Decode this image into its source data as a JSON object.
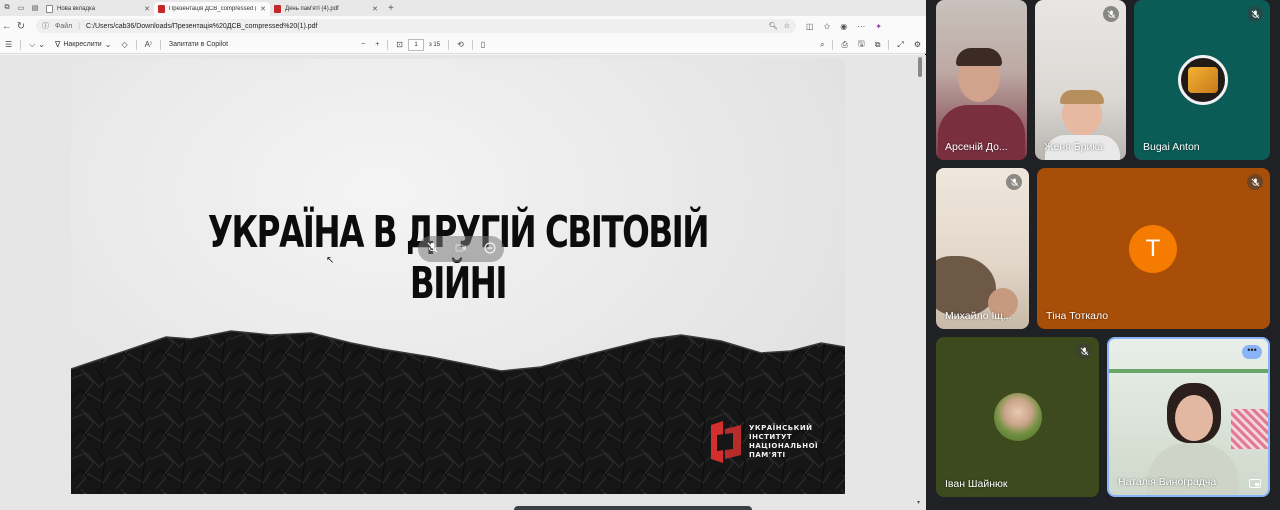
{
  "browser": {
    "tabs": [
      {
        "label": "Нова вкладка",
        "icon": "blank-page-icon",
        "active": false
      },
      {
        "label": "Презентація ДСВ_compressed (1)",
        "icon": "pdf-icon",
        "active": true
      },
      {
        "label": "День пам'яті (4).pdf",
        "icon": "pdf-icon",
        "active": false
      }
    ],
    "new_tab": "+",
    "address": {
      "protocol_label": "Файл",
      "url": "C:/Users/cab36/Downloads/Презентація%20ДСВ_compressed%20(1).pdf"
    },
    "pdf_toolbar": {
      "draw_label": "Накреслити",
      "copilot_label": "Запитати в Copilot",
      "zoom_out": "−",
      "zoom_in": "+",
      "page_current": "1",
      "page_total": "з 15"
    }
  },
  "slide": {
    "title": "УКРАЇНА В ДРУГІЙ СВІТОВІЙ ВІЙНІ",
    "logo_lines": [
      "УКРАЇНСЬКИЙ",
      "ІНСТИТУТ",
      "НАЦІОНАЛЬНОЇ",
      "ПАМ'ЯТІ"
    ],
    "logo_color": "#d32f2f"
  },
  "participants": [
    {
      "name": "Арсеній До...",
      "muted": false,
      "video": true
    },
    {
      "name": "Женя Брика",
      "muted": true,
      "video": true
    },
    {
      "name": "Bugai Anton",
      "muted": true,
      "video": false
    },
    {
      "name": "Михайло Іщ...",
      "muted": true,
      "video": true
    },
    {
      "name": "Тіна Тоткало",
      "muted": true,
      "video": false,
      "initial": "T",
      "avatar_color": "#f57c00"
    },
    {
      "name": "Іван Шайнюк",
      "muted": true,
      "video": false
    },
    {
      "name": "Наталія Виноградча",
      "muted": false,
      "video": true,
      "more": "•••"
    }
  ],
  "colors": {
    "meet_bg": "#202124",
    "tile_bg": "#3c4043",
    "pdf_icon": "#c62828"
  }
}
